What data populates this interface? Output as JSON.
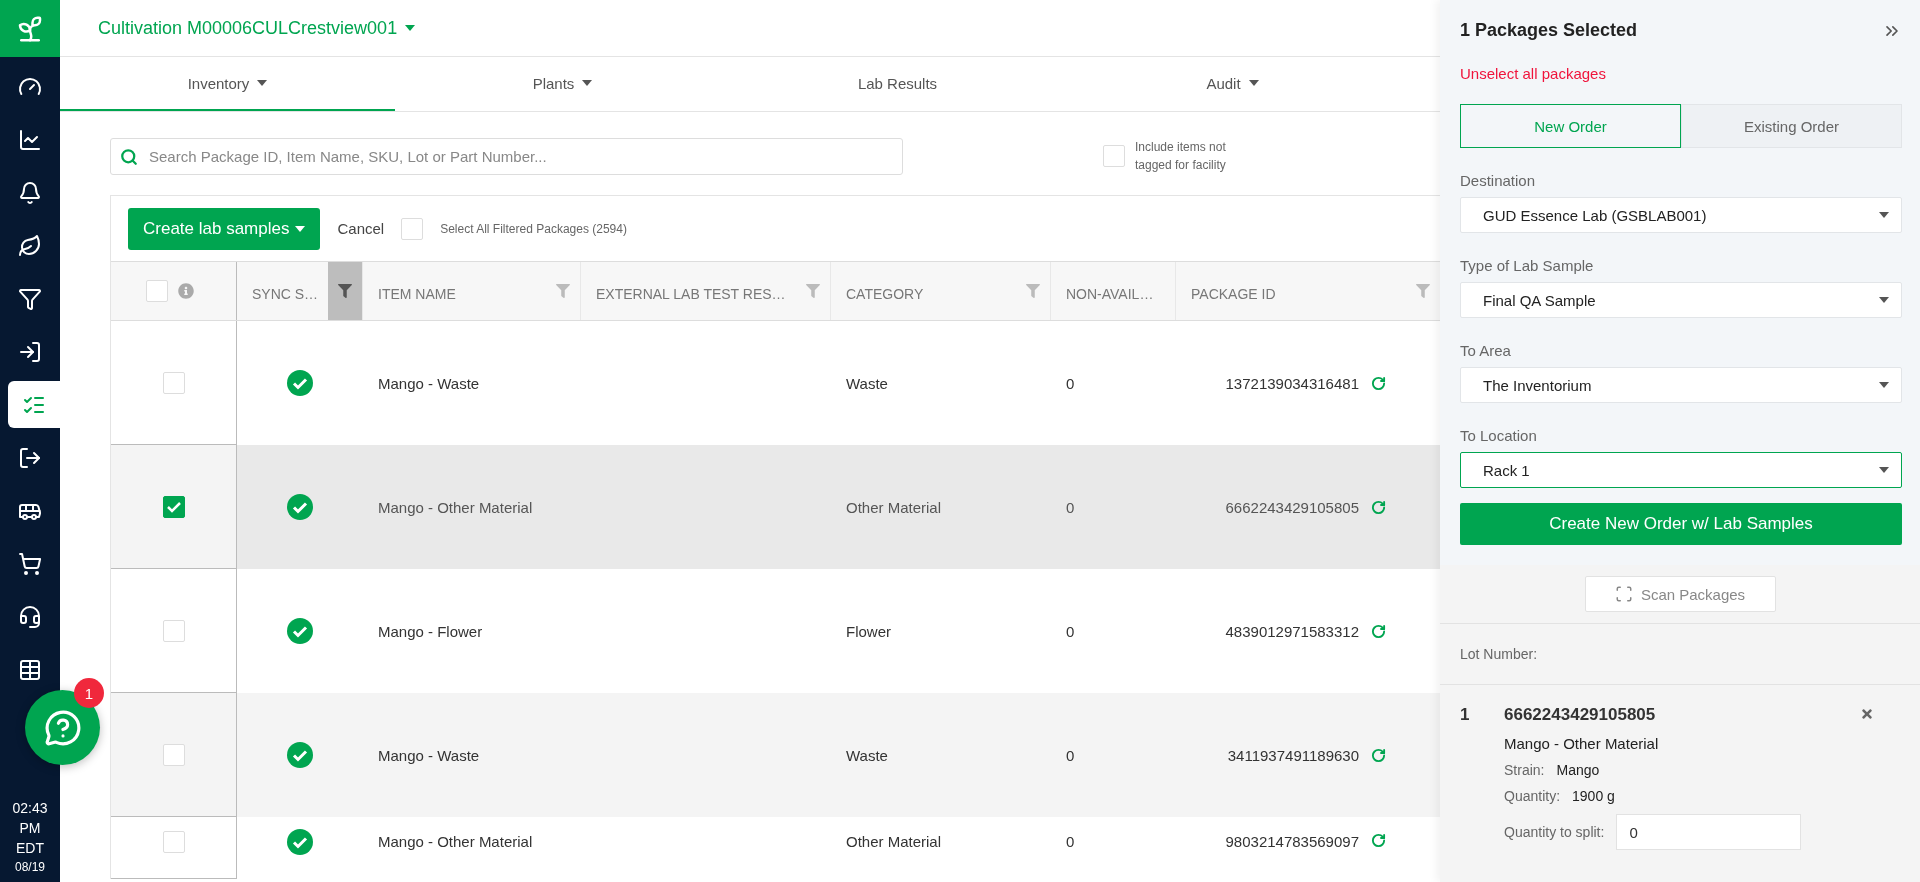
{
  "header": {
    "facility": "Cultivation M00006CULCrestview001"
  },
  "sidebar": {
    "items": [
      {
        "selected": false
      },
      {
        "selected": false
      },
      {
        "selected": false
      },
      {
        "selected": false
      },
      {
        "selected": false
      },
      {
        "selected": false
      },
      {
        "selected": true
      },
      {
        "selected": false
      },
      {
        "selected": false
      },
      {
        "selected": false
      },
      {
        "selected": false
      },
      {
        "selected": false
      }
    ]
  },
  "clock": {
    "time": "02:43",
    "meridiem": "PM",
    "zone": "EDT",
    "date": "08/19"
  },
  "chat": {
    "badge": "1"
  },
  "tabs": [
    {
      "label": "Inventory",
      "selected": true,
      "dropdown": true
    },
    {
      "label": "Plants",
      "selected": false,
      "dropdown": true
    },
    {
      "label": "Lab Results",
      "selected": false,
      "dropdown": false
    },
    {
      "label": "Audit",
      "selected": false,
      "dropdown": true
    }
  ],
  "search": {
    "placeholder": "Search Package ID, Item Name, SKU, Lot or Part Number..."
  },
  "include_untagged": {
    "label": "Include items not tagged for facility",
    "checked": false
  },
  "toolbar": {
    "primary": "Create lab samples",
    "cancel": "Cancel",
    "select_all": {
      "label": "Select All Filtered Packages (2594)",
      "checked": false
    }
  },
  "table": {
    "all_checked": false,
    "columns": [
      {
        "label": "SYNC S…",
        "filter": true,
        "filter_active": true
      },
      {
        "label": "ITEM NAME",
        "filter": true,
        "filter_active": false
      },
      {
        "label": "EXTERNAL LAB TEST RES…",
        "filter": true,
        "filter_active": false
      },
      {
        "label": "CATEGORY",
        "filter": true,
        "filter_active": false
      },
      {
        "label": "NON-AVAIL…",
        "filter": false
      },
      {
        "label": "PACKAGE ID",
        "filter": true,
        "filter_active": false
      }
    ],
    "rows": [
      {
        "selected": false,
        "synced": true,
        "item_name": "Mango - Waste",
        "category": "Waste",
        "non_available": "0",
        "package_id": "1372139034316481"
      },
      {
        "selected": true,
        "synced": true,
        "item_name": "Mango - Other Material",
        "category": "Other Material",
        "non_available": "0",
        "package_id": "6662243429105805"
      },
      {
        "selected": false,
        "synced": true,
        "item_name": "Mango - Flower",
        "category": "Flower",
        "non_available": "0",
        "package_id": "4839012971583312"
      },
      {
        "selected": false,
        "synced": true,
        "item_name": "Mango - Waste",
        "category": "Waste",
        "non_available": "0",
        "package_id": "3411937491189630"
      },
      {
        "selected": false,
        "synced": true,
        "item_name": "Mango - Other Material",
        "category": "Other Material",
        "non_available": "0",
        "package_id": "9803214783569097"
      }
    ]
  },
  "panel": {
    "title": "1 Packages Selected",
    "unselect": "Unselect all packages",
    "order_modes": [
      {
        "label": "New Order",
        "selected": true
      },
      {
        "label": "Existing Order",
        "selected": false
      }
    ],
    "fields": [
      {
        "label": "Destination",
        "value": "GUD Essence Lab (GSBLAB001)",
        "focused": false
      },
      {
        "label": "Type of Lab Sample",
        "value": "Final QA Sample",
        "focused": false
      },
      {
        "label": "To Area",
        "value": "The Inventorium",
        "focused": false
      },
      {
        "label": "To Location",
        "value": "Rack 1",
        "focused": true
      }
    ],
    "submit": "Create New Order w/ Lab Samples",
    "scan": "Scan Packages",
    "lot_label": "Lot Number:",
    "packages": [
      {
        "index": "1",
        "package_id": "6662243429105805",
        "name": "Mango - Other Material",
        "details": [
          {
            "label": "Strain:",
            "value": "Mango"
          },
          {
            "label": "Quantity:",
            "value": "1900 g"
          }
        ],
        "split_label": "Quantity to split:",
        "split_value": "0"
      }
    ]
  }
}
